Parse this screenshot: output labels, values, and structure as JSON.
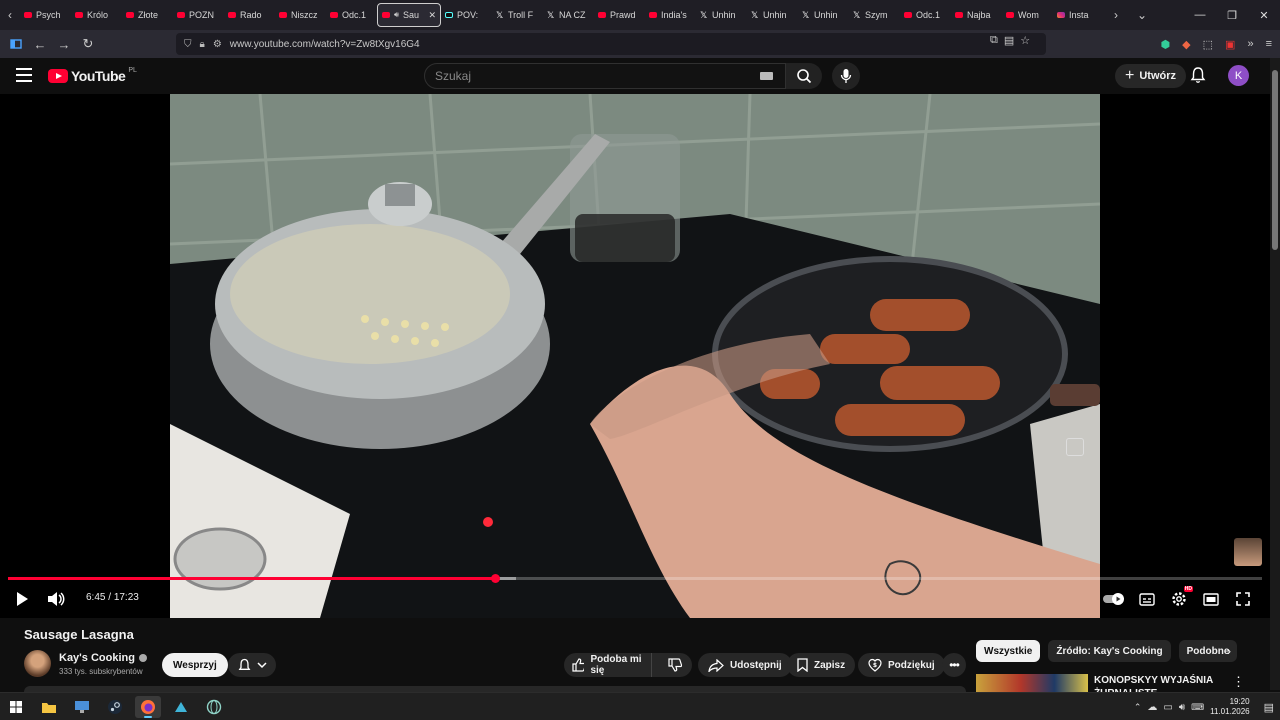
{
  "browser": {
    "tabs": [
      {
        "label": "Psych",
        "icon": "youtube-icon"
      },
      {
        "label": "Królo",
        "icon": "youtube-icon"
      },
      {
        "label": "Złote",
        "icon": "youtube-icon"
      },
      {
        "label": "POZN",
        "icon": "youtube-icon"
      },
      {
        "label": "Rado",
        "icon": "youtube-icon"
      },
      {
        "label": "Niszcz",
        "icon": "youtube-icon"
      },
      {
        "label": "Odc.1",
        "icon": "youtube-icon"
      },
      {
        "label": "Sau",
        "icon": "youtube-icon",
        "active": true
      },
      {
        "label": "POV:",
        "icon": "tiktok-icon"
      },
      {
        "label": "Troll F",
        "icon": "x-icon"
      },
      {
        "label": "NA CZ",
        "icon": "x-icon"
      },
      {
        "label": "Prawd",
        "icon": "youtube-icon"
      },
      {
        "label": "India's",
        "icon": "youtube-icon"
      },
      {
        "label": "Unhin",
        "icon": "x-icon"
      },
      {
        "label": "Unhin",
        "icon": "x-icon"
      },
      {
        "label": "Unhin",
        "icon": "x-icon"
      },
      {
        "label": "Szym",
        "icon": "x-icon"
      },
      {
        "label": "Odc.1",
        "icon": "youtube-icon"
      },
      {
        "label": "Najba",
        "icon": "youtube-icon"
      },
      {
        "label": "Wom",
        "icon": "youtube-icon"
      },
      {
        "label": "Insta",
        "icon": "instagram-icon"
      }
    ],
    "url": "www.youtube.com/watch?v=Zw8tXgv16G4"
  },
  "masthead": {
    "logo_text": "YouTube",
    "logo_region": "PL",
    "search_placeholder": "Szukaj",
    "create_label": "Utwórz",
    "avatar_letter": "K"
  },
  "player": {
    "current_time": "6:45",
    "duration": "17:23",
    "time_separator": " / ",
    "progress_fraction": 0.3884,
    "buffered_fraction": 0.405
  },
  "video": {
    "title": "Sausage Lasagna",
    "channel_name": "Kay's Cooking",
    "subscribers": "333 tys. subskrybentów",
    "support_label": "Wesprzyj",
    "like_label": "Podoba mi się",
    "share_label": "Udostępnij",
    "save_label": "Zapisz",
    "thanks_label": "Podziękuj"
  },
  "sidebar": {
    "chips": [
      {
        "label": "Wszystkie",
        "active": true
      },
      {
        "label": "Źródło: Kay's Cooking",
        "active": false
      },
      {
        "label": "Podobne",
        "active": false
      }
    ],
    "recommendation_title": "KONOPSKYY WYJAŚNIA ŻURNALISTE"
  },
  "taskbar": {
    "time": "19:20",
    "date": "11.01.2026"
  },
  "colors": {
    "accent": "#ff0033",
    "background": "#0f0f0f",
    "chip": "#272727"
  }
}
